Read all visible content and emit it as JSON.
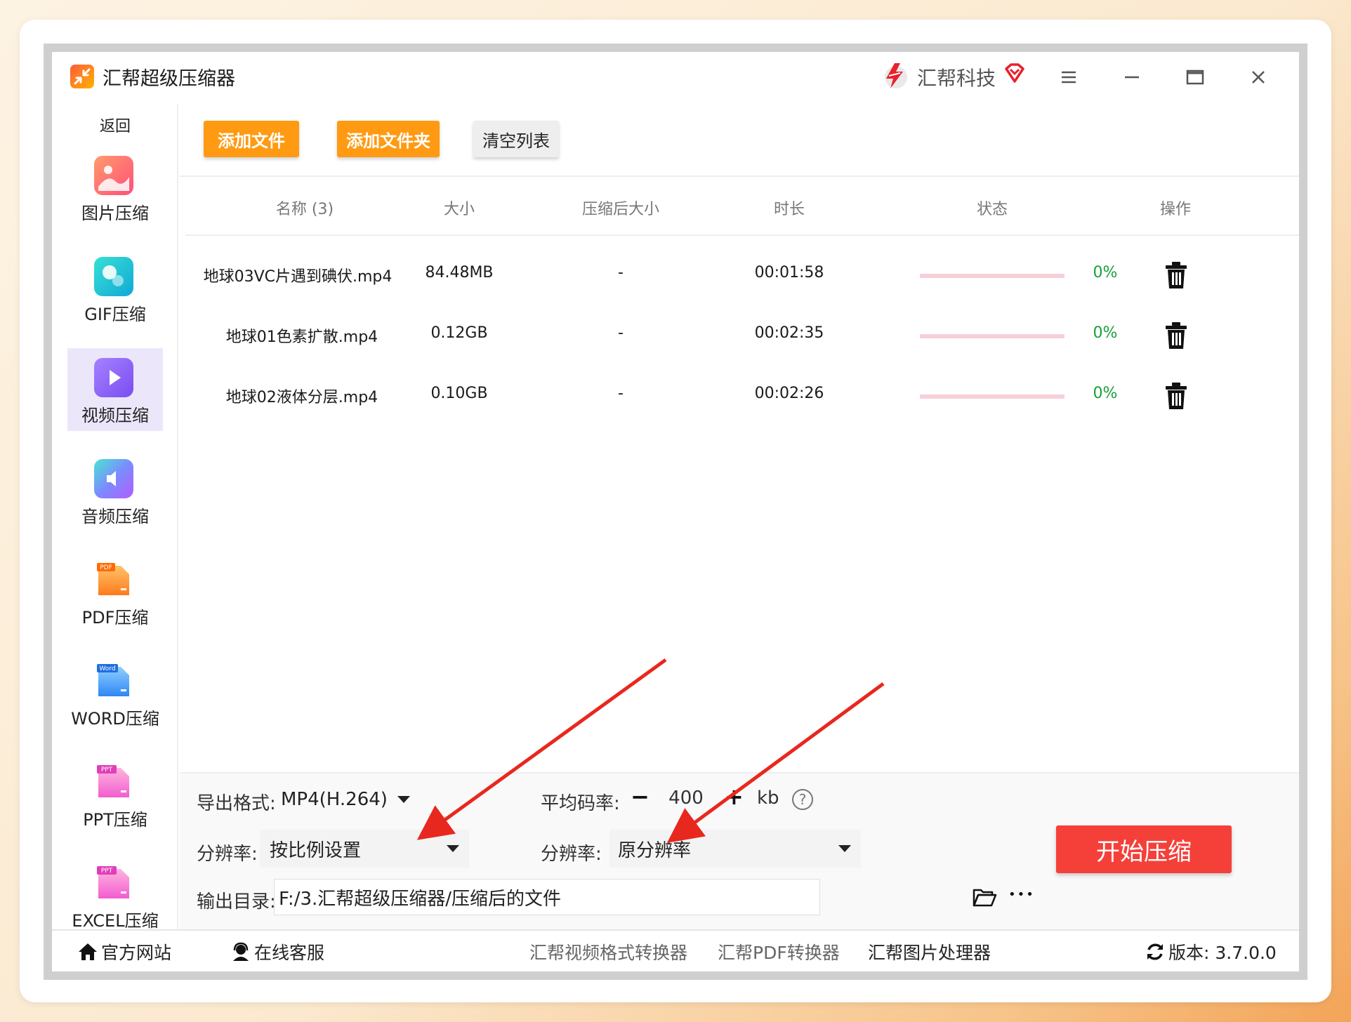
{
  "app": {
    "title": "汇帮超级压缩器",
    "brand": "汇帮科技"
  },
  "sidebar": {
    "back": "返回",
    "items": [
      {
        "label": "图片压缩",
        "icon": "image-icon"
      },
      {
        "label": "GIF压缩",
        "icon": "gif-icon"
      },
      {
        "label": "视频压缩",
        "icon": "video-play-icon",
        "active": true
      },
      {
        "label": "音频压缩",
        "icon": "audio-speaker-icon"
      },
      {
        "label": "PDF压缩",
        "icon": "pdf-file-icon",
        "badge": "PDF"
      },
      {
        "label": "WORD压缩",
        "icon": "word-file-icon",
        "badge": "Word"
      },
      {
        "label": "PPT压缩",
        "icon": "ppt-file-icon",
        "badge": "PPT"
      },
      {
        "label": "EXCEL压缩",
        "icon": "excel-file-icon",
        "badge": "PPT"
      }
    ]
  },
  "toolbar": {
    "add_file": "添加文件",
    "add_folder": "添加文件夹",
    "clear_list": "清空列表"
  },
  "table": {
    "headers": {
      "name": "名称 (3)",
      "size": "大小",
      "compressed_size": "压缩后大小",
      "duration": "时长",
      "status": "状态",
      "action": "操作"
    },
    "rows": [
      {
        "name": "地球03VC片遇到碘伏.mp4",
        "size": "84.48MB",
        "compressed": "-",
        "duration": "00:01:58",
        "progress": 0,
        "percent": "0%"
      },
      {
        "name": "地球01色素扩散.mp4",
        "size": "0.12GB",
        "compressed": "-",
        "duration": "00:02:35",
        "progress": 0,
        "percent": "0%"
      },
      {
        "name": "地球02液体分层.mp4",
        "size": "0.10GB",
        "compressed": "-",
        "duration": "00:02:26",
        "progress": 0,
        "percent": "0%"
      }
    ]
  },
  "settings": {
    "format_label": "导出格式:",
    "format_value": "MP4(H.264)",
    "bitrate_label": "平均码率:",
    "bitrate_minus": "−",
    "bitrate_value": "400",
    "bitrate_plus": "+",
    "bitrate_unit": "kb",
    "help": "?",
    "resolution_label_1": "分辨率:",
    "resolution_value_1": "按比例设置",
    "resolution_label_2": "分辨率:",
    "resolution_value_2": "原分辨率",
    "output_label": "输出目录:",
    "output_path": "F:/3.汇帮超级压缩器/压缩后的文件",
    "more": "•••",
    "start_button": "开始压缩"
  },
  "footer": {
    "website": "官方网站",
    "support": "在线客服",
    "link1": "汇帮视频格式转换器",
    "link2": "汇帮PDF转换器",
    "link3": "汇帮图片处理器",
    "version": "版本: 3.7.0.0"
  },
  "colors": {
    "orange_button": "#ff9a12",
    "start_button": "#f5403a",
    "active_nav": "#ece6fb",
    "percent_green": "#18a03a",
    "annotation_arrow": "#e8281e"
  }
}
